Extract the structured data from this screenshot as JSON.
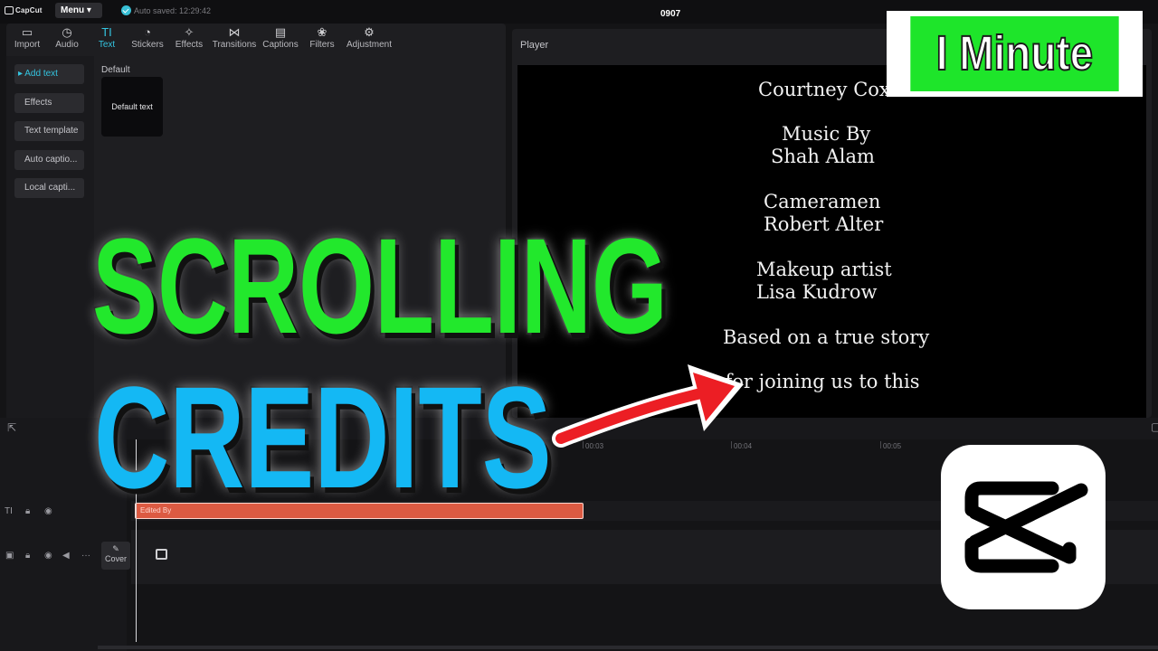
{
  "header": {
    "app_name": "CapCut",
    "menu_label": "Menu",
    "autosave": "Auto saved: 12:29:42",
    "project_name": "0907"
  },
  "tabs": [
    {
      "label": "Import",
      "icon": "import-icon",
      "glyph": "▭"
    },
    {
      "label": "Audio",
      "icon": "audio-icon",
      "glyph": "◷"
    },
    {
      "label": "Text",
      "icon": "text-icon",
      "glyph": "TI"
    },
    {
      "label": "Stickers",
      "icon": "sticker-icon",
      "glyph": "◔"
    },
    {
      "label": "Effects",
      "icon": "effects-icon",
      "glyph": "✧"
    },
    {
      "label": "Transitions",
      "icon": "transitions-icon",
      "glyph": "⋈"
    },
    {
      "label": "Captions",
      "icon": "captions-icon",
      "glyph": "▤"
    },
    {
      "label": "Filters",
      "icon": "filters-icon",
      "glyph": "❀"
    },
    {
      "label": "Adjustment",
      "icon": "adjustment-icon",
      "glyph": "⚙"
    }
  ],
  "sidebar": {
    "items": [
      {
        "label": "▸ Add text"
      },
      {
        "label": "Effects"
      },
      {
        "label": "Text template"
      },
      {
        "label": "Auto captio..."
      },
      {
        "label": "Local capti..."
      }
    ]
  },
  "text_panel": {
    "section": "Default",
    "card_label": "Default text"
  },
  "player": {
    "title": "Player",
    "credits": [
      "Courtney Cox",
      "Music By",
      "Shah Alam",
      "Cameramen",
      "Robert Alter",
      "Makeup artist",
      "Lisa Kudrow",
      "Based on a true story",
      "s for joining us to this"
    ]
  },
  "timeline": {
    "ticks": [
      "00:03",
      "00:04",
      "00:05"
    ],
    "clip_label": "Edited By",
    "cover_label": "Cover"
  },
  "overlay": {
    "badge": "I Minute",
    "headline_1": "SCROLLING",
    "headline_2": "CREDITS"
  },
  "colors": {
    "accent": "#34c5e1",
    "clip": "#dc5a42",
    "headline_green": "#22e82c",
    "headline_blue": "#14b8f4",
    "badge_green": "#1ee52a",
    "arrow_red": "#ec1e24"
  }
}
